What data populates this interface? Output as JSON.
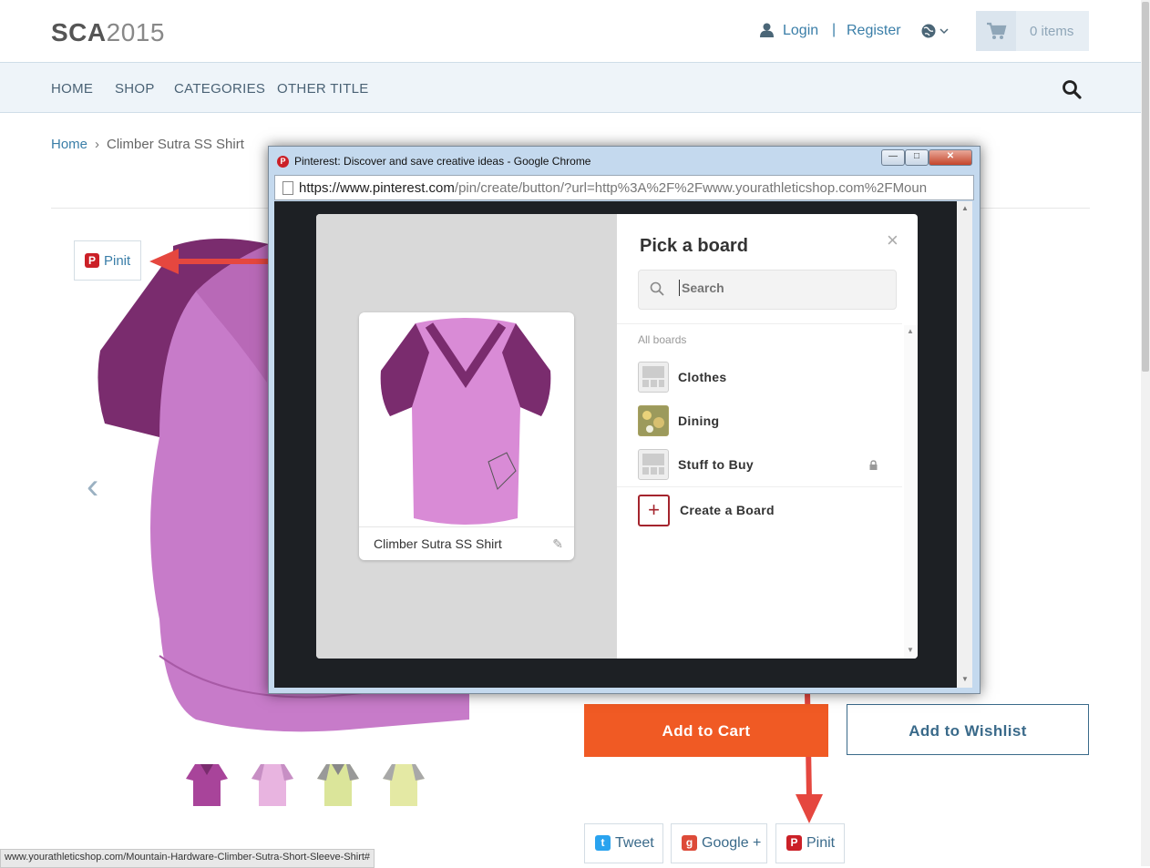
{
  "header": {
    "logo_bold": "SCA",
    "logo_light": "2015",
    "login": "Login",
    "separator": "|",
    "register": "Register",
    "cart_label": "0 items"
  },
  "nav": {
    "items": [
      "HOME",
      "SHOP",
      "CATEGORIES",
      "OTHER TITLE"
    ]
  },
  "breadcrumb": {
    "home": "Home",
    "sep": "›",
    "current": "Climber Sutra SS Shirt"
  },
  "product": {
    "pinit_label": "Pinit",
    "prev_arrow": "‹",
    "add_to_cart": "Add to Cart",
    "add_to_wishlist": "Add to Wishlist",
    "share": {
      "tweet": "Tweet",
      "google": "Google +",
      "pinit": "Pinit"
    },
    "colors": {
      "shirt_body": "#c77bc9",
      "shirt_sleeve": "#7a2c6e",
      "accent_orange": "#f05a24",
      "link_blue": "#3a7ea8"
    }
  },
  "status_bar": "www.yourathleticshop.com/Mountain-Hardware-Climber-Sutra-Short-Sleeve-Shirt#",
  "popup": {
    "window_title": "Pinterest: Discover and save creative ideas - Google Chrome",
    "url_host": "https://www.pinterest.com",
    "url_path": "/pin/create/button/?url=http%3A%2F%2Fwww.yourathleticshop.com%2FMoun",
    "pin_caption": "Climber Sutra SS Shirt",
    "modal_title": "Pick a board",
    "search_placeholder": "Search",
    "all_boards_label": "All boards",
    "boards": [
      {
        "name": "Clothes"
      },
      {
        "name": "Dining"
      },
      {
        "name": "Stuff to Buy"
      }
    ],
    "create_board": "Create a Board"
  }
}
